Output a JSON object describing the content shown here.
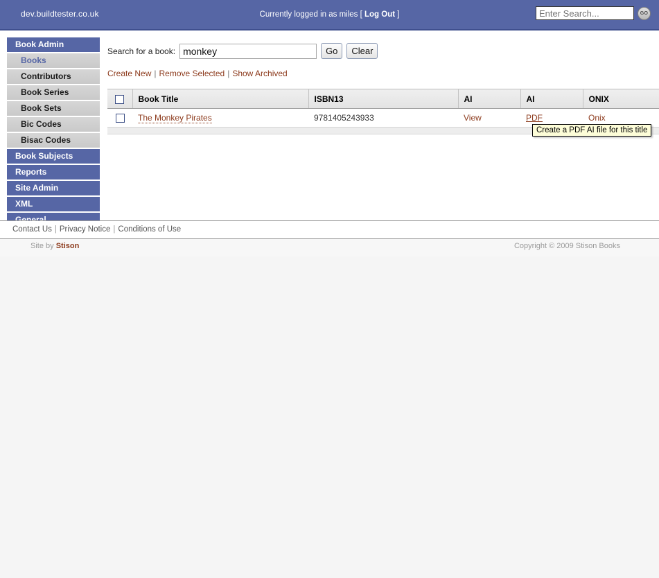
{
  "header": {
    "site_host": "dev.buildtester.co.uk",
    "login_prefix": "Currently logged in as miles [ ",
    "login_user": "miles",
    "logout_label": "Log Out",
    "login_suffix": " ]",
    "search_placeholder": "Enter Search...",
    "search_value": "",
    "go_label": "GO"
  },
  "sidebar": {
    "sections": [
      {
        "type": "section",
        "label": "Book Admin",
        "active": false
      },
      {
        "type": "item",
        "label": "Books",
        "active": true
      },
      {
        "type": "item",
        "label": "Contributors",
        "active": false
      },
      {
        "type": "item",
        "label": "Book Series",
        "active": false
      },
      {
        "type": "item",
        "label": "Book Sets",
        "active": false
      },
      {
        "type": "item",
        "label": "Bic Codes",
        "active": false
      },
      {
        "type": "item",
        "label": "Bisac Codes",
        "active": false
      },
      {
        "type": "section",
        "label": "Book Subjects",
        "active": false
      },
      {
        "type": "section",
        "label": "Reports",
        "active": false
      },
      {
        "type": "section",
        "label": "Site Admin",
        "active": false
      },
      {
        "type": "section",
        "label": "XML",
        "active": false
      },
      {
        "type": "section",
        "label": "General",
        "active": false
      }
    ]
  },
  "main": {
    "search_label": "Search for a book:",
    "search_value": "monkey",
    "search_placeholder": "",
    "go_button": "Go",
    "clear_button": "Clear",
    "actions": [
      {
        "label": "Create New"
      },
      {
        "label": "Remove Selected"
      },
      {
        "label": "Show Archived"
      }
    ],
    "action_separator": "|",
    "table": {
      "columns": [
        "",
        "Book Title",
        "ISBN13",
        "AI",
        "AI",
        "ONIX"
      ],
      "rows": [
        {
          "title": "The Monkey Pirates",
          "isbn13": "9781405243933",
          "ai_view": "View",
          "ai_pdf": "PDF",
          "onix": "Onix"
        }
      ]
    },
    "tooltip": "Create a PDF AI file for this title"
  },
  "footer": {
    "links": [
      {
        "label": "Contact Us"
      },
      {
        "label": "Privacy Notice"
      },
      {
        "label": "Conditions of Use"
      }
    ],
    "link_separator": "|",
    "site_by_prefix": "Site by ",
    "site_by_brand": "Stison",
    "copyright": "Copyright © 2009 Stison Books"
  },
  "colors": {
    "header_blue": "#5666a5",
    "link_brown": "#8c3a1c",
    "tooltip_bg": "#fdfdd8",
    "nav_item_gray": "#d0d0d0"
  }
}
